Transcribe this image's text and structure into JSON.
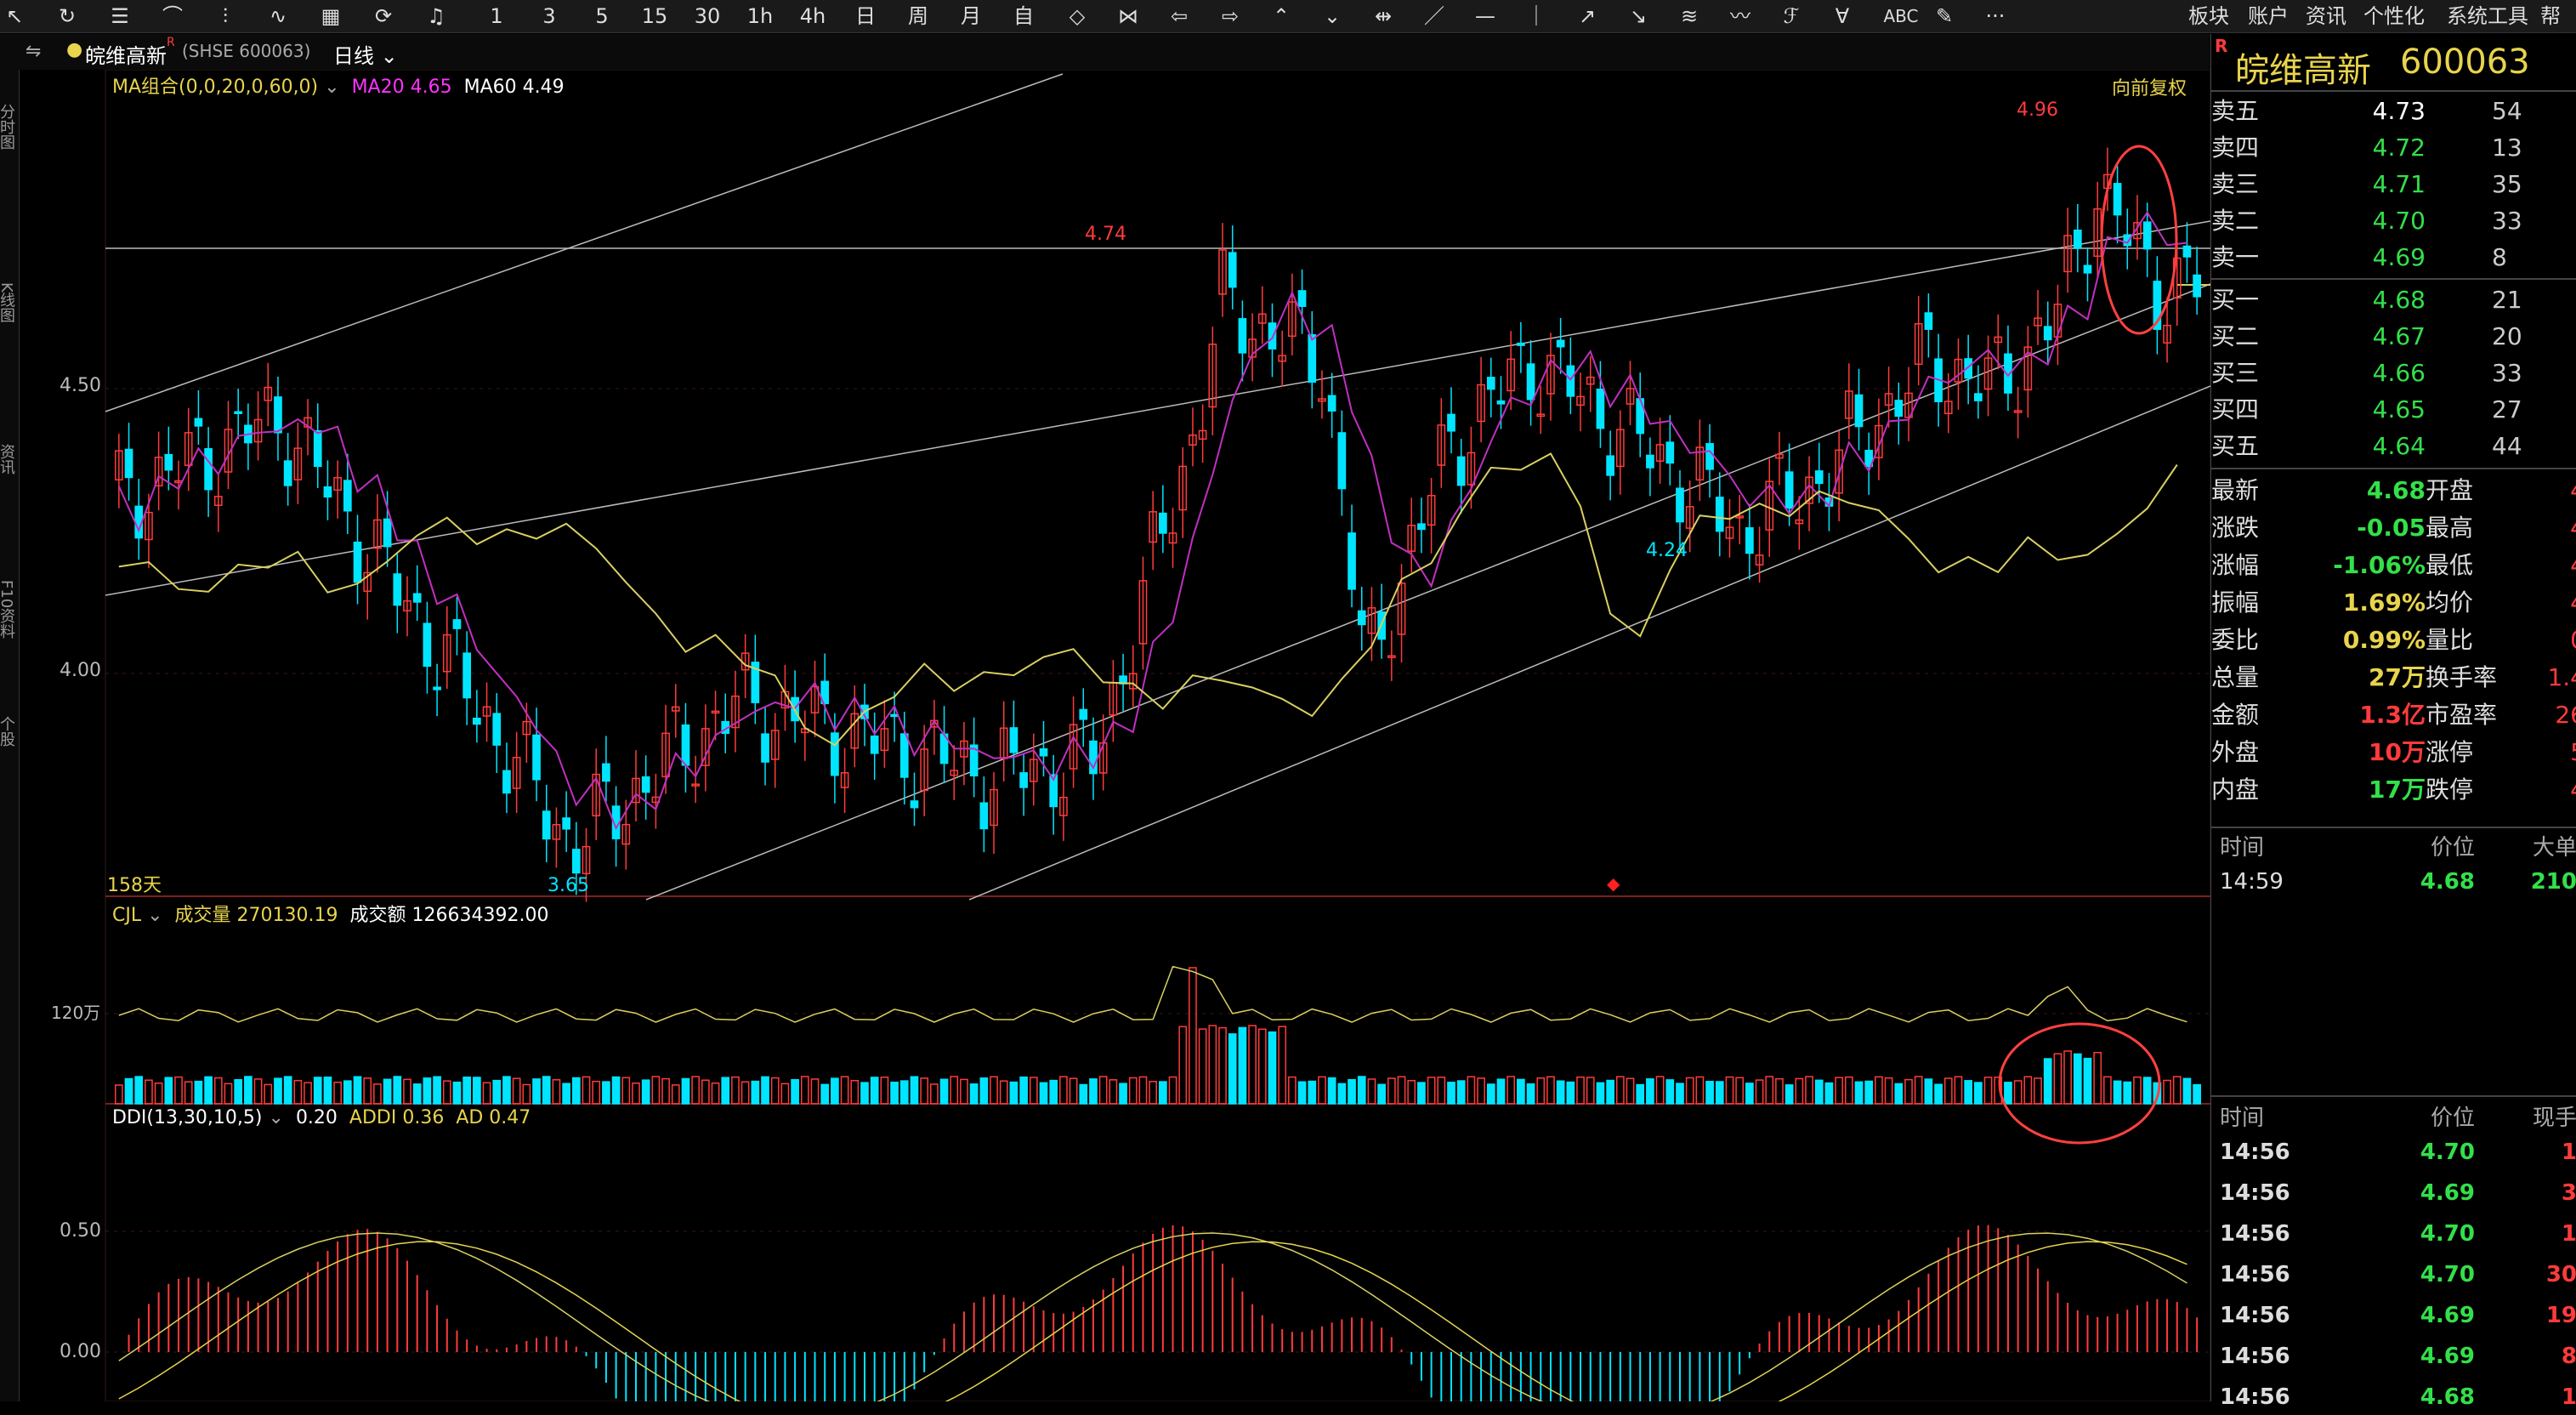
{
  "toolbar": {
    "icons": [
      "back-icon",
      "refresh-icon",
      "list-icon",
      "chart-icon",
      "candle-icon",
      "indicator-icon",
      "overview-icon",
      "share-icon",
      "bell-icon"
    ],
    "periods": [
      "1",
      "3",
      "5",
      "15",
      "30",
      "1h",
      "4h",
      "日",
      "周",
      "月",
      "自"
    ],
    "draw_tools": [
      "zoom-icon",
      "shrink-icon",
      "left-icon",
      "right-icon",
      "up-icon",
      "down-icon",
      "move-icon",
      "line-icon",
      "ray-icon",
      "hline-icon",
      "vline-icon",
      "channel-icon",
      "arrow-icon",
      "parallel-icon",
      "wave-icon",
      "text-icon",
      "abc-label",
      "pen-icon",
      "more-icon"
    ],
    "abc": "ABC",
    "more": "···",
    "menus": [
      "板块",
      "账户",
      "资讯",
      "个性化",
      "系统工具",
      "帮"
    ]
  },
  "title": {
    "stock_name": "皖维高新",
    "sup": "R",
    "code": "(SHSE 600063)",
    "period": "日线"
  },
  "ma": {
    "label": "MA组合(0,0,20,0,60,0)",
    "ma20": "MA20 4.65",
    "ma60": "MA60 4.49",
    "adjust": "向前复权"
  },
  "price_axis": {
    "labels": [
      "4.50",
      "4.00"
    ]
  },
  "annotations": {
    "high_1": "4.74",
    "high_2": "4.96",
    "low_1": "3.65",
    "low_2": "4.24",
    "days": "158天"
  },
  "cjl": {
    "label": "CJL",
    "vol": "成交量 270130.19",
    "amount": "成交额 126634392.00",
    "axis": "120万"
  },
  "ddi": {
    "label": "DDI(13,30,10,5)",
    "ddi": "0.20",
    "addi": "ADDI 0.36",
    "ad": "AD 0.47",
    "axis": [
      "0.50",
      "0.00"
    ]
  },
  "quote": {
    "badge": "R",
    "name": "皖维高新",
    "code": "600063",
    "asks": [
      {
        "label": "卖五",
        "price": "4.73",
        "vol": "54"
      },
      {
        "label": "卖四",
        "price": "4.72",
        "vol": "13"
      },
      {
        "label": "卖三",
        "price": "4.71",
        "vol": "35"
      },
      {
        "label": "卖二",
        "price": "4.70",
        "vol": "33"
      },
      {
        "label": "卖一",
        "price": "4.69",
        "vol": "8"
      }
    ],
    "bids": [
      {
        "label": "买一",
        "price": "4.68",
        "vol": "21"
      },
      {
        "label": "买二",
        "price": "4.67",
        "vol": "20"
      },
      {
        "label": "买三",
        "price": "4.66",
        "vol": "33"
      },
      {
        "label": "买四",
        "price": "4.65",
        "vol": "27"
      },
      {
        "label": "买五",
        "price": "4.64",
        "vol": "44"
      }
    ],
    "stats": [
      {
        "l1": "最新",
        "v1": "4.68",
        "c1": "#33e04a",
        "l2": "开盘",
        "v2": "4"
      },
      {
        "l1": "涨跌",
        "v1": "-0.05",
        "c1": "#33e04a",
        "l2": "最高",
        "v2": "4"
      },
      {
        "l1": "涨幅",
        "v1": "-1.06%",
        "c1": "#33e04a",
        "l2": "最低",
        "v2": "4"
      },
      {
        "l1": "振幅",
        "v1": "1.69%",
        "c1": "#e8d44d",
        "l2": "均价",
        "v2": "4"
      },
      {
        "l1": "委比",
        "v1": "0.99%",
        "c1": "#e8d44d",
        "l2": "量比",
        "v2": "0"
      },
      {
        "l1": "总量",
        "v1": "27万",
        "c1": "#e8d44d",
        "l2": "换手率",
        "v2": "1.4"
      },
      {
        "l1": "金额",
        "v1": "1.3亿",
        "c1": "#ff3b3b",
        "l2": "市盈率",
        "v2": "26"
      },
      {
        "l1": "外盘",
        "v1": "10万",
        "c1": "#ff3b3b",
        "l2": "涨停",
        "v2": "5"
      },
      {
        "l1": "内盘",
        "v1": "17万",
        "c1": "#33e04a",
        "l2": "跌停",
        "v2": "4"
      }
    ],
    "deal_header": {
      "time": "时间",
      "price": "价位",
      "vol": "大单"
    },
    "deal_row": {
      "time": "14:59",
      "price": "4.68",
      "vol": "210"
    },
    "tick_header": {
      "time": "时间",
      "price": "价位",
      "vol": "现手"
    },
    "ticks": [
      {
        "time": "14:56",
        "price": "4.70",
        "vol": "1"
      },
      {
        "time": "14:56",
        "price": "4.69",
        "vol": "3"
      },
      {
        "time": "14:56",
        "price": "4.70",
        "vol": "1"
      },
      {
        "time": "14:56",
        "price": "4.70",
        "vol": "30"
      },
      {
        "time": "14:56",
        "price": "4.69",
        "vol": "19"
      },
      {
        "time": "14:56",
        "price": "4.69",
        "vol": "8"
      },
      {
        "time": "14:56",
        "price": "4.68",
        "vol": "1"
      }
    ]
  },
  "left_rail": [
    "分时图",
    "K线图",
    "资讯",
    "F10资料",
    "个股"
  ],
  "colors": {
    "up": "#ff3b3b",
    "down": "#00e5ff",
    "ma20": "#c030c0",
    "ma60": "#d8d060",
    "bg": "#000000"
  }
}
